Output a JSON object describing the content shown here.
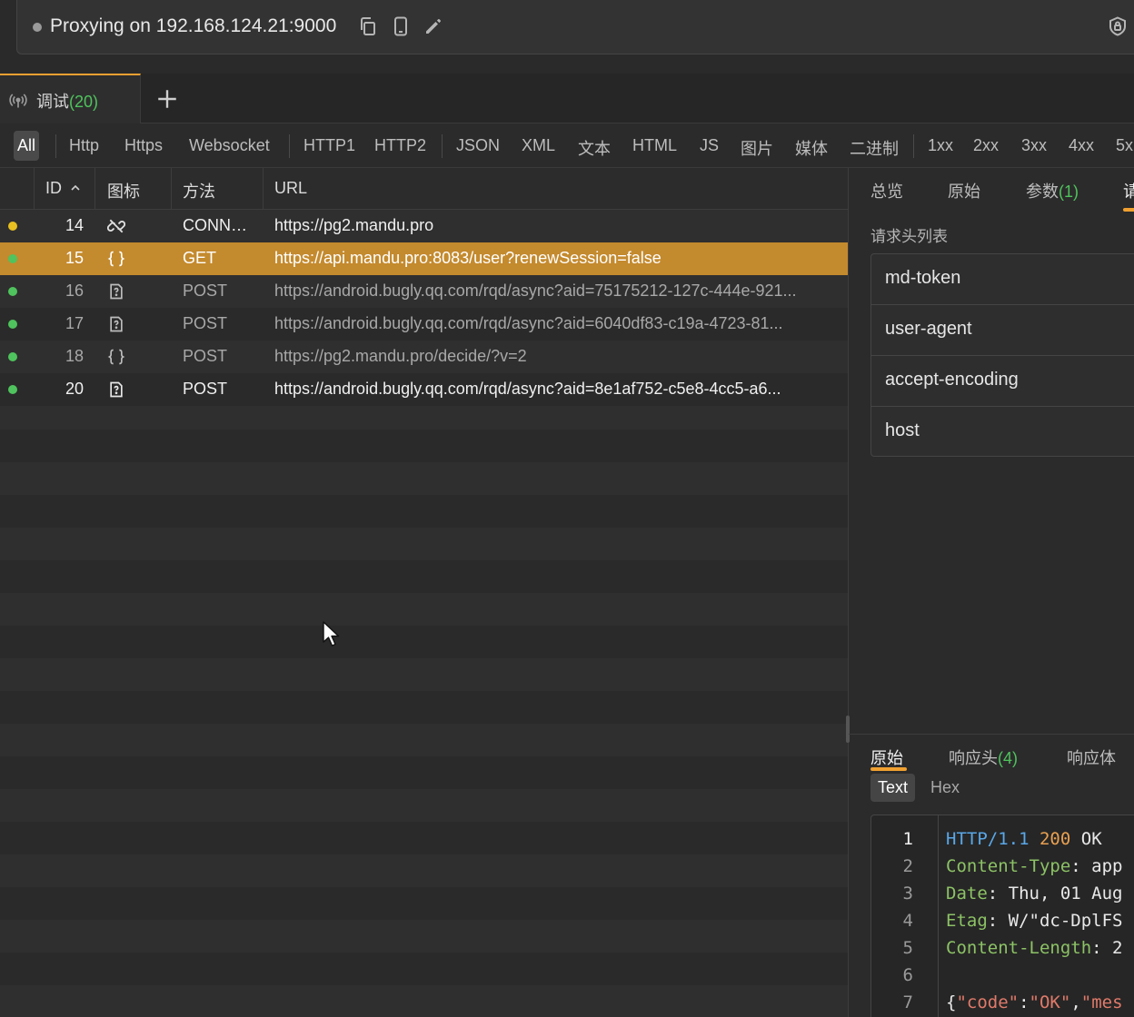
{
  "proxy": {
    "status_text": "Proxying on 192.168.124.21:9000",
    "icons": [
      "copy-icon",
      "phone-icon",
      "edit-icon",
      "shield-icon"
    ]
  },
  "session_tab": {
    "label": "调试",
    "count": "(20)"
  },
  "filters": {
    "all": "All",
    "http": "Http",
    "https": "Https",
    "websocket": "Websocket",
    "http1": "HTTP1",
    "http2": "HTTP2",
    "json": "JSON",
    "xml": "XML",
    "text": "文本",
    "html": "HTML",
    "js": "JS",
    "image": "图片",
    "media": "媒体",
    "binary": "二进制",
    "s1xx": "1xx",
    "s2xx": "2xx",
    "s3xx": "3xx",
    "s4xx": "4xx",
    "s5xx": "5x"
  },
  "table": {
    "headers": {
      "id": "ID",
      "icon": "图标",
      "method": "方法",
      "url": "URL"
    },
    "rows": [
      {
        "id": "14",
        "status": "#e8c020",
        "icon": "unlink-icon",
        "method": "CONN…",
        "url": "https://pg2.mandu.pro"
      },
      {
        "id": "15",
        "status": "#4fc35d",
        "icon": "json-braces-icon",
        "method": "GET",
        "url": "https://api.mandu.pro:8083/user?renewSession=false"
      },
      {
        "id": "16",
        "status": "#4fc35d",
        "icon": "unknown-file-icon",
        "method": "POST",
        "url": "https://android.bugly.qq.com/rqd/async?aid=75175212-127c-444e-921..."
      },
      {
        "id": "17",
        "status": "#4fc35d",
        "icon": "unknown-file-icon",
        "method": "POST",
        "url": "https://android.bugly.qq.com/rqd/async?aid=6040df83-c19a-4723-81..."
      },
      {
        "id": "18",
        "status": "#4fc35d",
        "icon": "json-braces-icon",
        "method": "POST",
        "url": "https://pg2.mandu.pro/decide/?v=2"
      },
      {
        "id": "20",
        "status": "#4fc35d",
        "icon": "unknown-file-icon",
        "method": "POST",
        "url": "https://android.bugly.qq.com/rqd/async?aid=8e1af752-c5e8-4cc5-a6..."
      }
    ]
  },
  "request_tabs": {
    "overview": "总览",
    "raw": "原始",
    "params": "参数",
    "params_count": "(1)",
    "headers_cut": "请"
  },
  "request_headers": {
    "title": "请求头列表",
    "items": [
      "md-token",
      "user-agent",
      "accept-encoding",
      "host"
    ]
  },
  "response_tabs": {
    "raw": "原始",
    "headers": "响应头",
    "headers_count": "(4)",
    "body": "响应体"
  },
  "response_view": {
    "text": "Text",
    "hex": "Hex"
  },
  "response_raw": {
    "line_numbers": [
      "1",
      "2",
      "3",
      "4",
      "5",
      "6",
      "7"
    ],
    "l1_proto": "HTTP/1.1",
    "l1_code": "200",
    "l1_msg": "OK",
    "l2_key": "Content-Type",
    "l2_val": ": app",
    "l3_key": "Date",
    "l3_val": ": Thu, 01 Aug",
    "l4_key": "Etag",
    "l4_val": ": W/\"dc-DplFS",
    "l5_key": "Content-Length",
    "l5_val": ": 2",
    "l7_open": "{",
    "l7_key": "\"code\"",
    "l7_colon": ":",
    "l7_val": "\"OK\"",
    "l7_comma": ",",
    "l7_key2": "\"mes"
  },
  "colors": {
    "accent": "#f0a030",
    "selected_row": "#c48a2e",
    "count_green": "#4fc35d"
  }
}
